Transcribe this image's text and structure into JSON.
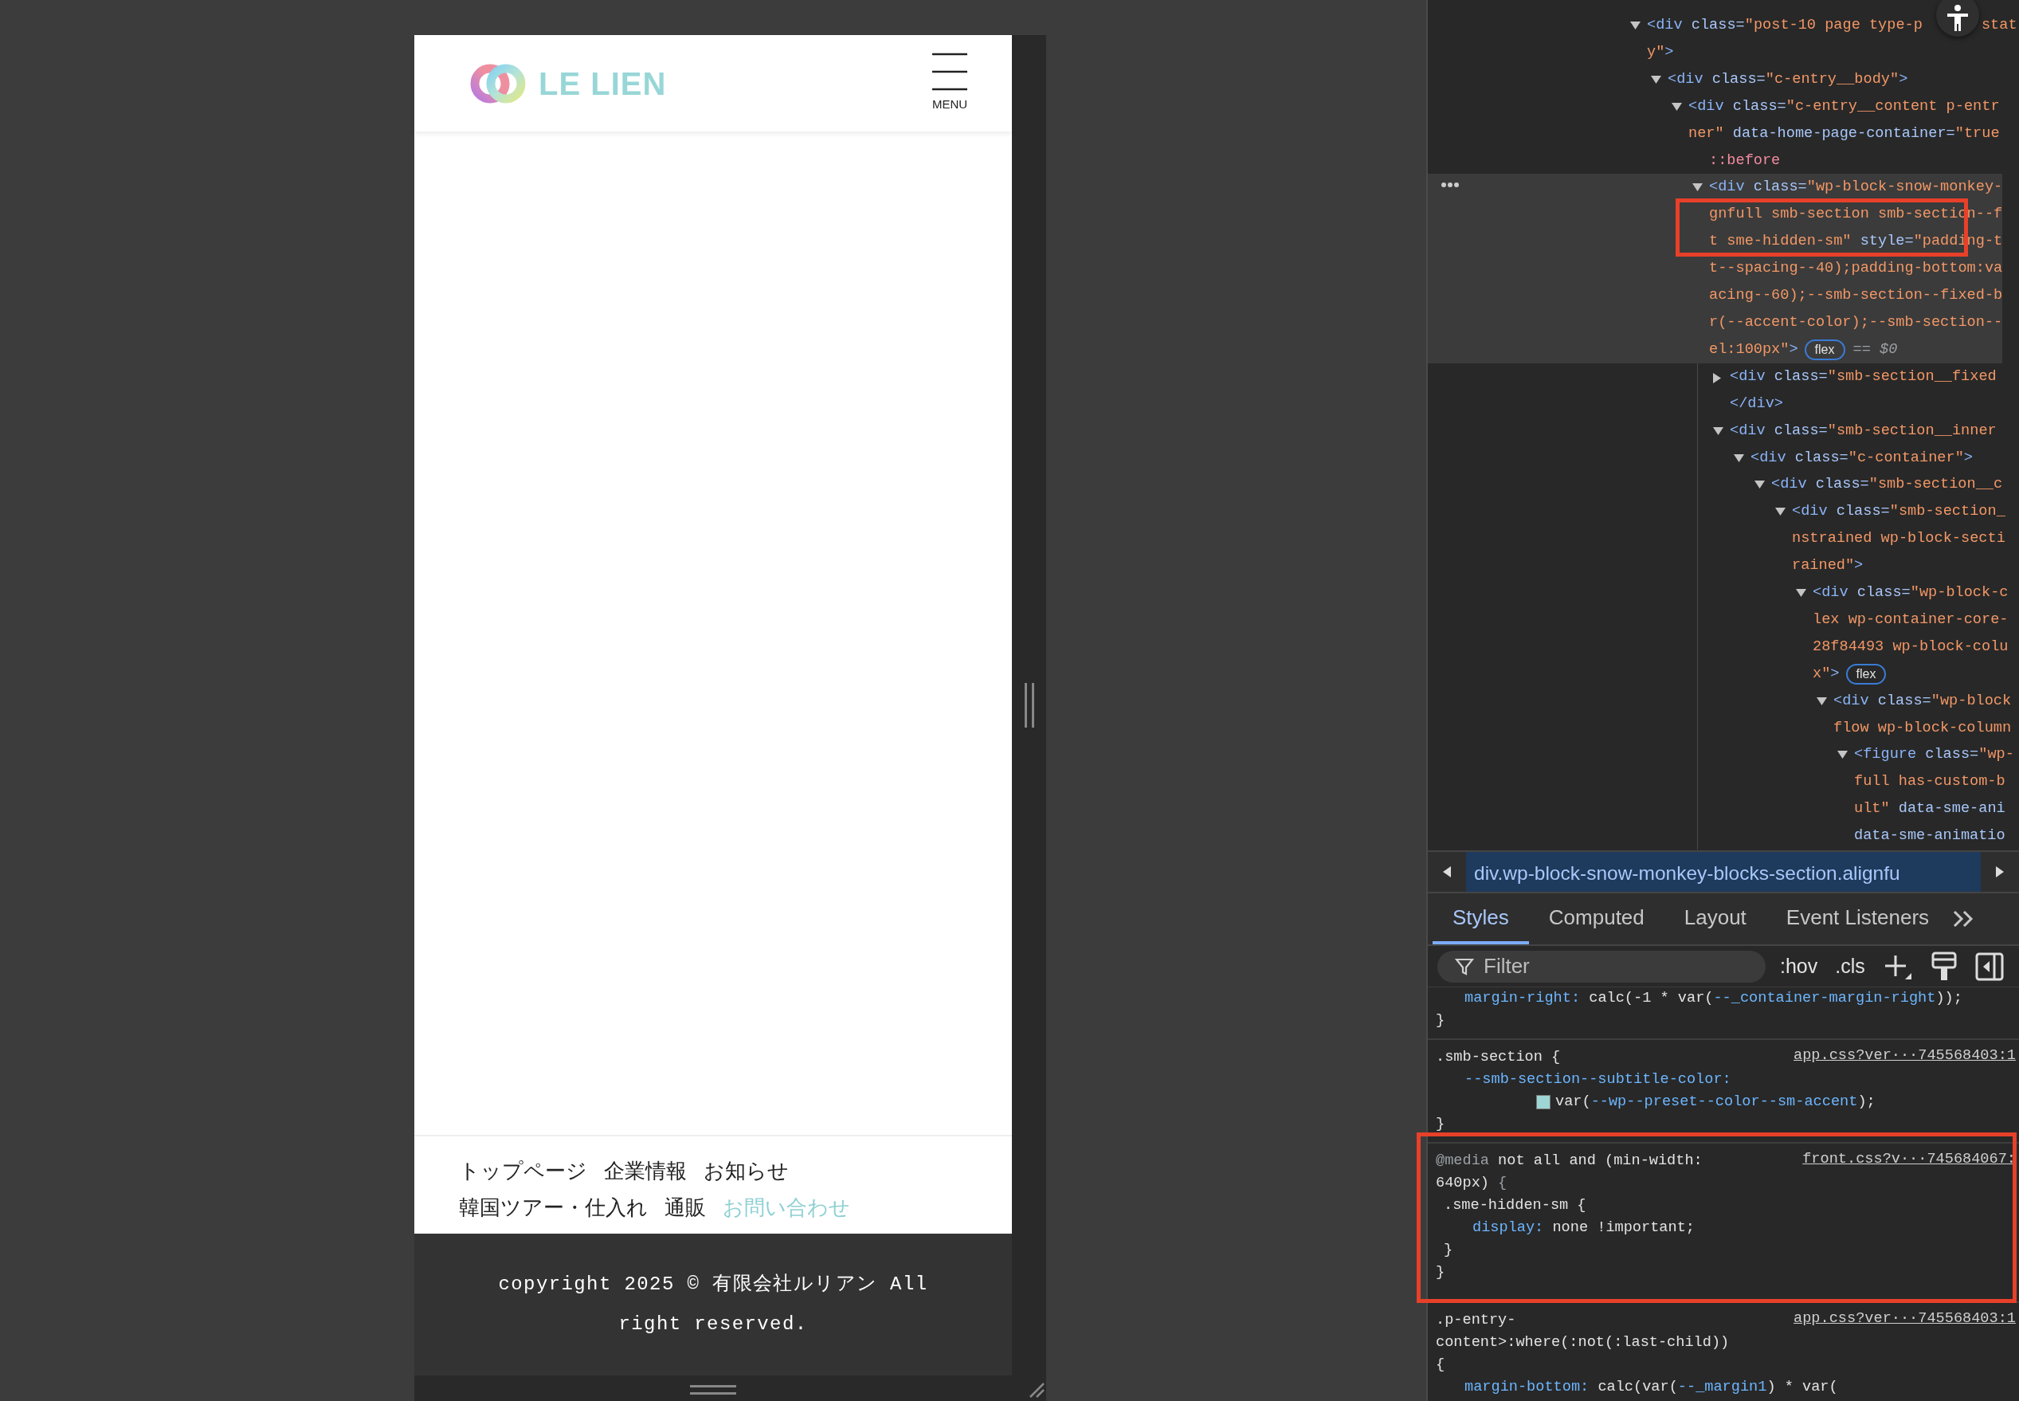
{
  "device_preview": {
    "logo_text": "LE LIEN",
    "menu_label": "MENU",
    "footer_nav": [
      {
        "label": "トップページ",
        "selected": false
      },
      {
        "label": "企業情報",
        "selected": false
      },
      {
        "label": "お知らせ",
        "selected": false
      },
      {
        "label": "韓国ツアー・仕入れ",
        "selected": false
      },
      {
        "label": "通販",
        "selected": false
      },
      {
        "label": "お問い合わせ",
        "selected": true
      }
    ],
    "copyright": "copyright 2025 © 有限会社ルリアン All right reserved."
  },
  "devtools": {
    "elements_tree": {
      "nodes": [
        {
          "expanded": true,
          "selected": false,
          "lines": [
            [
              {
                "kind": "tag",
                "s": "<div"
              },
              {
                "kind": "attr",
                "s": " class="
              },
              {
                "kind": "val",
                "s": "\"post-10 page type-p"
              },
              {
                "kind": "val",
                "s": "stat",
                "gap": true
              }
            ],
            [
              {
                "kind": "val",
                "s": "y\""
              },
              {
                "kind": "tag",
                "s": ">"
              }
            ]
          ],
          "children": [
            {
              "expanded": true,
              "selected": false,
              "lines": [
                [
                  {
                    "kind": "tag",
                    "s": "<div"
                  },
                  {
                    "kind": "attr",
                    "s": " class="
                  },
                  {
                    "kind": "val",
                    "s": "\"c-entry__body\""
                  },
                  {
                    "kind": "tag",
                    "s": ">"
                  }
                ]
              ],
              "children": [
                {
                  "expanded": true,
                  "selected": false,
                  "lines": [
                    [
                      {
                        "kind": "tag",
                        "s": "<div"
                      },
                      {
                        "kind": "attr",
                        "s": " class="
                      },
                      {
                        "kind": "val",
                        "s": "\"c-entry__content p-entr"
                      }
                    ],
                    [
                      {
                        "kind": "val",
                        "s": "ner\""
                      },
                      {
                        "kind": "attr",
                        "s": " data-home-page-container="
                      },
                      {
                        "kind": "val",
                        "s": "\"true"
                      }
                    ]
                  ],
                  "children": [
                    {
                      "selected": false,
                      "lines": [
                        [
                          {
                            "kind": "pseudo",
                            "s": "::before"
                          }
                        ]
                      ]
                    },
                    {
                      "expanded": true,
                      "selected": true,
                      "lines": [
                        [
                          {
                            "kind": "tag",
                            "s": "<div"
                          },
                          {
                            "kind": "attr",
                            "s": " class="
                          },
                          {
                            "kind": "val",
                            "s": "\"wp-block-snow-monkey-"
                          }
                        ],
                        [
                          {
                            "kind": "val",
                            "s": "gnfull smb-section smb-section--f"
                          }
                        ],
                        [
                          {
                            "kind": "val",
                            "s": "t sme-hidden-sm\""
                          },
                          {
                            "kind": "attr",
                            "s": " style="
                          },
                          {
                            "kind": "val",
                            "s": "\"padding-t"
                          }
                        ],
                        [
                          {
                            "kind": "val",
                            "s": "t--spacing--40);padding-bottom:va"
                          }
                        ],
                        [
                          {
                            "kind": "val",
                            "s": "acing--60);--smb-section--fixed-b"
                          }
                        ],
                        [
                          {
                            "kind": "val",
                            "s": "r(--accent-color);--smb-section--"
                          }
                        ],
                        [
                          {
                            "kind": "val",
                            "s": "el:100px\""
                          },
                          {
                            "kind": "tag",
                            "s": ">"
                          },
                          {
                            "kind": "badge",
                            "s": "flex"
                          },
                          {
                            "kind": "ref",
                            "s": "== $0"
                          }
                        ]
                      ],
                      "children": [
                        {
                          "expanded": false,
                          "selected": false,
                          "lines": [
                            [
                              {
                                "kind": "tag",
                                "s": "<div"
                              },
                              {
                                "kind": "attr",
                                "s": " class="
                              },
                              {
                                "kind": "val",
                                "s": "\"smb-section__fixed"
                              }
                            ],
                            [
                              {
                                "kind": "tag",
                                "s": "</div>"
                              }
                            ]
                          ]
                        },
                        {
                          "expanded": true,
                          "selected": false,
                          "lines": [
                            [
                              {
                                "kind": "tag",
                                "s": "<div"
                              },
                              {
                                "kind": "attr",
                                "s": " class="
                              },
                              {
                                "kind": "val",
                                "s": "\"smb-section__inner"
                              }
                            ]
                          ],
                          "children": [
                            {
                              "expanded": true,
                              "selected": false,
                              "lines": [
                                [
                                  {
                                    "kind": "tag",
                                    "s": "<div"
                                  },
                                  {
                                    "kind": "attr",
                                    "s": " class="
                                  },
                                  {
                                    "kind": "val",
                                    "s": "\"c-container\""
                                  },
                                  {
                                    "kind": "tag",
                                    "s": ">"
                                  }
                                ]
                              ],
                              "children": [
                                {
                                  "expanded": true,
                                  "selected": false,
                                  "lines": [
                                    [
                                      {
                                        "kind": "tag",
                                        "s": "<div"
                                      },
                                      {
                                        "kind": "attr",
                                        "s": " class="
                                      },
                                      {
                                        "kind": "val",
                                        "s": "\"smb-section__c"
                                      }
                                    ]
                                  ],
                                  "children": [
                                    {
                                      "expanded": true,
                                      "selected": false,
                                      "lines": [
                                        [
                                          {
                                            "kind": "tag",
                                            "s": "<div"
                                          },
                                          {
                                            "kind": "attr",
                                            "s": " class="
                                          },
                                          {
                                            "kind": "val",
                                            "s": "\"smb-section_"
                                          }
                                        ],
                                        [
                                          {
                                            "kind": "val",
                                            "s": "nstrained wp-block-secti"
                                          }
                                        ],
                                        [
                                          {
                                            "kind": "val",
                                            "s": "rained\""
                                          },
                                          {
                                            "kind": "tag",
                                            "s": ">"
                                          }
                                        ]
                                      ],
                                      "children": [
                                        {
                                          "expanded": true,
                                          "selected": false,
                                          "lines": [
                                            [
                                              {
                                                "kind": "tag",
                                                "s": "<div"
                                              },
                                              {
                                                "kind": "attr",
                                                "s": " class="
                                              },
                                              {
                                                "kind": "val",
                                                "s": "\"wp-block-c"
                                              }
                                            ],
                                            [
                                              {
                                                "kind": "val",
                                                "s": "lex wp-container-core-"
                                              }
                                            ],
                                            [
                                              {
                                                "kind": "val",
                                                "s": "28f84493 wp-block-colu"
                                              }
                                            ],
                                            [
                                              {
                                                "kind": "val",
                                                "s": "x\""
                                              },
                                              {
                                                "kind": "tag",
                                                "s": ">"
                                              },
                                              {
                                                "kind": "badge",
                                                "s": "flex"
                                              }
                                            ]
                                          ],
                                          "children": [
                                            {
                                              "expanded": true,
                                              "selected": false,
                                              "lines": [
                                                [
                                                  {
                                                    "kind": "tag",
                                                    "s": "<div"
                                                  },
                                                  {
                                                    "kind": "attr",
                                                    "s": " class="
                                                  },
                                                  {
                                                    "kind": "val",
                                                    "s": "\"wp-block"
                                                  }
                                                ],
                                                [
                                                  {
                                                    "kind": "val",
                                                    "s": "flow wp-block-column"
                                                  }
                                                ]
                                              ],
                                              "children": [
                                                {
                                                  "expanded": true,
                                                  "selected": false,
                                                  "lines": [
                                                    [
                                                      {
                                                        "kind": "tag",
                                                        "s": "<figure"
                                                      },
                                                      {
                                                        "kind": "attr",
                                                        "s": " class="
                                                      },
                                                      {
                                                        "kind": "val",
                                                        "s": "\"wp-"
                                                      }
                                                    ],
                                                    [
                                                      {
                                                        "kind": "val",
                                                        "s": "full has-custom-b"
                                                      }
                                                    ],
                                                    [
                                                      {
                                                        "kind": "val",
                                                        "s": "ult\""
                                                      },
                                                      {
                                                        "kind": "attr",
                                                        "s": " data-sme-ani"
                                                      }
                                                    ],
                                                    [
                                                      {
                                                        "kind": "attr",
                                                        "s": "data-sme-animatio"
                                                      }
                                                    ]
                                                  ]
                                                }
                                              ]
                                            }
                                          ]
                                        }
                                      ]
                                    }
                                  ]
                                }
                              ]
                            }
                          ]
                        }
                      ]
                    }
                  ]
                }
              ]
            }
          ]
        }
      ]
    },
    "breadcrumb": "div.wp-block-snow-monkey-blocks-section.alignfu",
    "tabs": [
      {
        "label": "Styles",
        "selected": true
      },
      {
        "label": "Computed",
        "selected": false
      },
      {
        "label": "Layout",
        "selected": false
      },
      {
        "label": "Event Listeners",
        "selected": false
      }
    ],
    "filter": {
      "placeholder": "Filter"
    },
    "toolbar_buttons": [
      ":hov",
      ".cls"
    ],
    "style_rules": [
      {
        "declarations": [
          {
            "prop": "margin-right:",
            "value_inline": true,
            "value_lines": [
              [
                {
                  "kind": "plain",
                  "s": "calc(-1 * var("
                },
                {
                  "kind": "var",
                  "s": "--_container-margin-right"
                },
                {
                  "kind": "plain",
                  "s": "));"
                }
              ]
            ]
          }
        ],
        "close": "}"
      },
      {
        "source": "app.css?ver···745568403:1",
        "selector_lines": [
          [
            {
              "kind": "plain",
              "s": ".smb-section {"
            }
          ]
        ],
        "declarations": [
          {
            "prop": "--smb-section--subtitle-color:",
            "value_inline": false,
            "color": "#9dd6d4",
            "value_lines": [
              [
                {
                  "kind": "plain",
                  "s": "var("
                },
                {
                  "kind": "var",
                  "s": "--wp--preset--color--sm-accent"
                },
                {
                  "kind": "plain",
                  "s": ");"
                }
              ]
            ]
          }
        ],
        "close": "}"
      },
      {
        "source": "front.css?v···745684067:",
        "media_lines": [
          [
            {
              "kind": "at",
              "s": "@media"
            },
            {
              "kind": "plain",
              "s": " not all and (min-width:"
            }
          ],
          [
            {
              "kind": "plain",
              "s": "640px) "
            },
            {
              "kind": "dim",
              "s": "{"
            }
          ]
        ],
        "inner": [
          {
            "selector_lines": [
              [
                {
                  "kind": "plain",
                  "s": ".sme-hidden-sm {"
                }
              ]
            ],
            "declarations": [
              {
                "prop": "display:",
                "value_inline": true,
                "value_lines": [
                  [
                    {
                      "kind": "plain",
                      "s": "none !important;"
                    }
                  ]
                ]
              }
            ],
            "close": "}"
          }
        ],
        "close": "}"
      },
      {
        "source": "app.css?ver···745568403:1",
        "selector_lines": [
          [
            {
              "kind": "plain",
              "s": ".p-entry-"
            }
          ],
          [
            {
              "kind": "plain",
              "s": "content>:where(:not(:last-child))"
            }
          ],
          [
            {
              "kind": "plain",
              "s": "{"
            }
          ]
        ],
        "declarations": [
          {
            "prop": "margin-bottom:",
            "value_inline": true,
            "value_lines": [
              [
                {
                  "kind": "plain",
                  "s": "calc(var("
                },
                {
                  "kind": "var",
                  "s": "--_margin1"
                },
                {
                  "kind": "plain",
                  "s": ") * var("
                }
              ]
            ]
          }
        ]
      }
    ]
  }
}
